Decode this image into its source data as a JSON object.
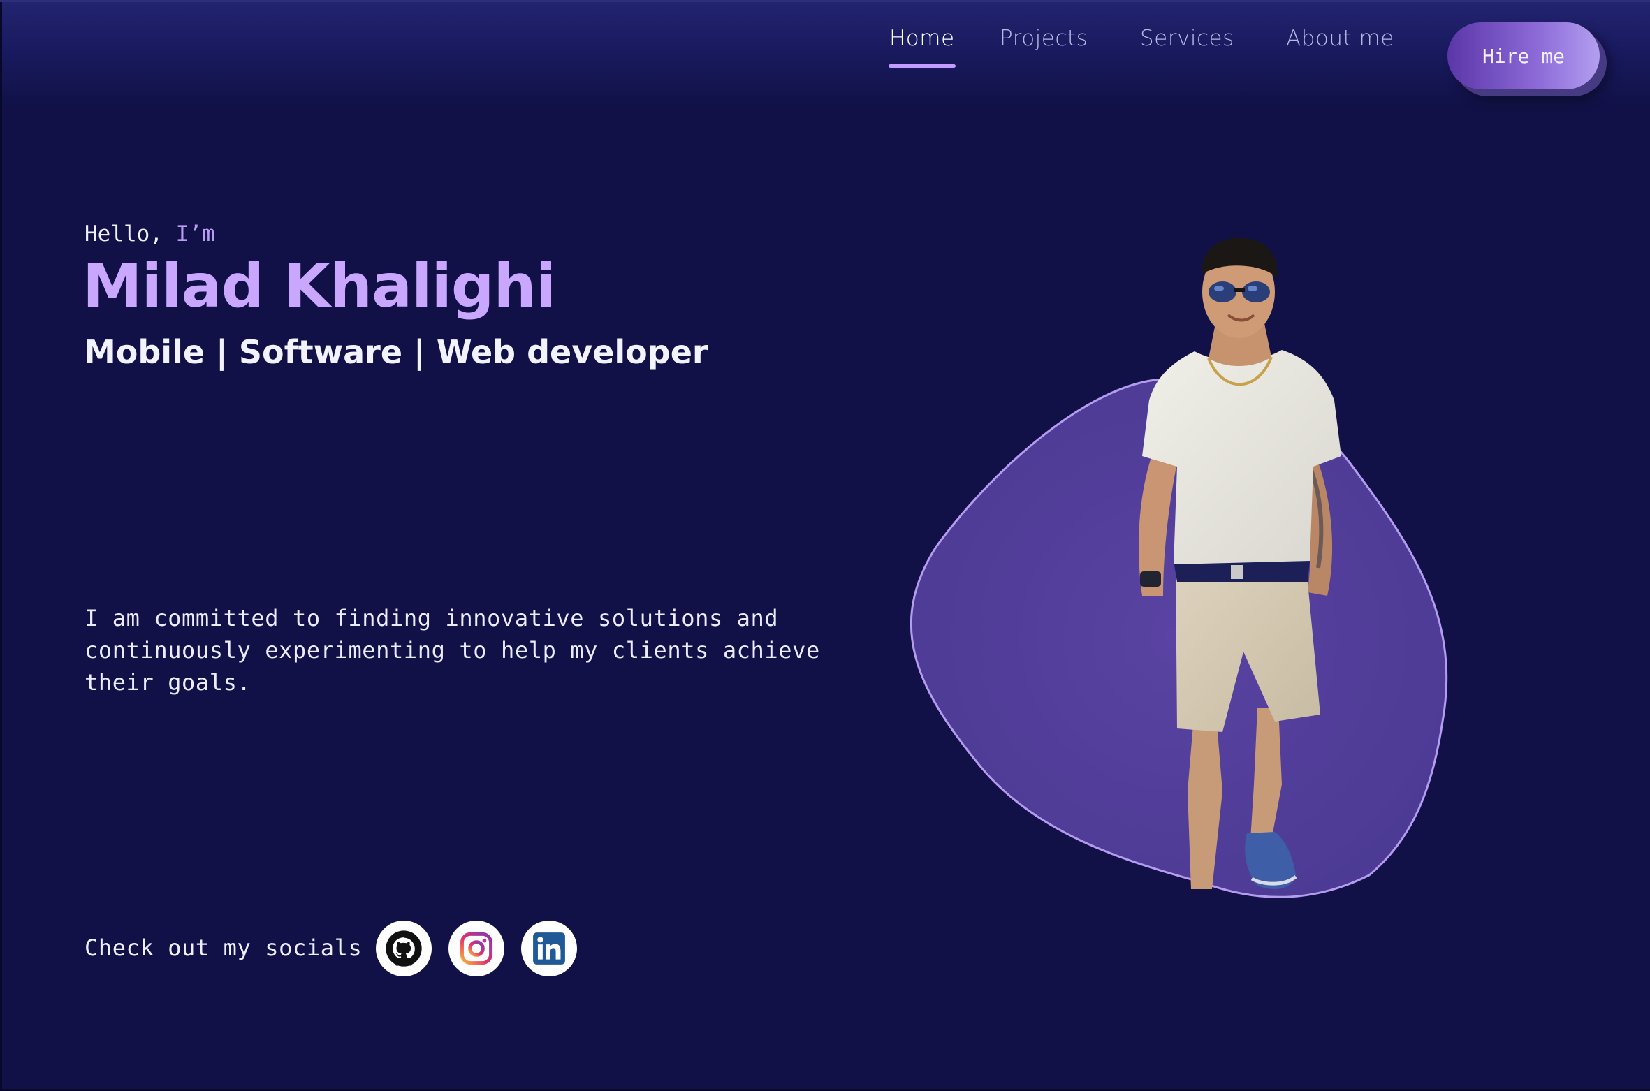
{
  "nav": {
    "items": [
      {
        "label": "Home",
        "active": true
      },
      {
        "label": "Projects",
        "active": false
      },
      {
        "label": "Services",
        "active": false
      },
      {
        "label": "About me",
        "active": false
      }
    ],
    "hire_label": "Hire me"
  },
  "hero": {
    "hello": "Hello,",
    "hello_accent": "I’m",
    "name": "Milad Khalighi",
    "role": "Mobile | Software | Web developer",
    "bio": "I am committed to finding innovative solutions and continuously experimenting to help my clients achieve their goals.",
    "socials_label": "Check out my socials"
  },
  "socials": [
    {
      "name": "github",
      "icon": "github-icon"
    },
    {
      "name": "instagram",
      "icon": "instagram-icon"
    },
    {
      "name": "linkedin",
      "icon": "linkedin-icon"
    }
  ],
  "colors": {
    "background": "#111147",
    "accent": "#c9a7ff",
    "blob": "#523e98",
    "button": "#8d6bd8"
  }
}
